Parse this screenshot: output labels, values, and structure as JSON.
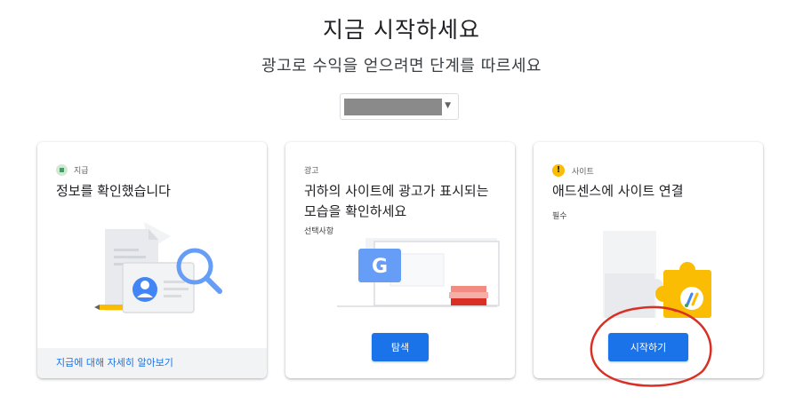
{
  "header": {
    "title": "지금 시작하세요",
    "subtitle": "광고로 수익을 얻으려면 단계를 따르세요"
  },
  "account_selector": {
    "caret": "▼"
  },
  "cards": [
    {
      "label": "지급",
      "title": "정보를 확인했습니다",
      "footer_link": "지급에 대해 자세히 알아보기"
    },
    {
      "label": "광고",
      "title": "귀하의 사이트에 광고가 표시되는 모습을 확인하세요",
      "note": "선택사항",
      "button": "탐색"
    },
    {
      "label": "사이트",
      "title": "애드센스에 사이트 연결",
      "note": "필수",
      "button": "시작하기"
    }
  ],
  "colors": {
    "accent": "#1a73e8",
    "warning": "#fbbc04",
    "success": "#34a853",
    "annotation": "#d93025"
  }
}
